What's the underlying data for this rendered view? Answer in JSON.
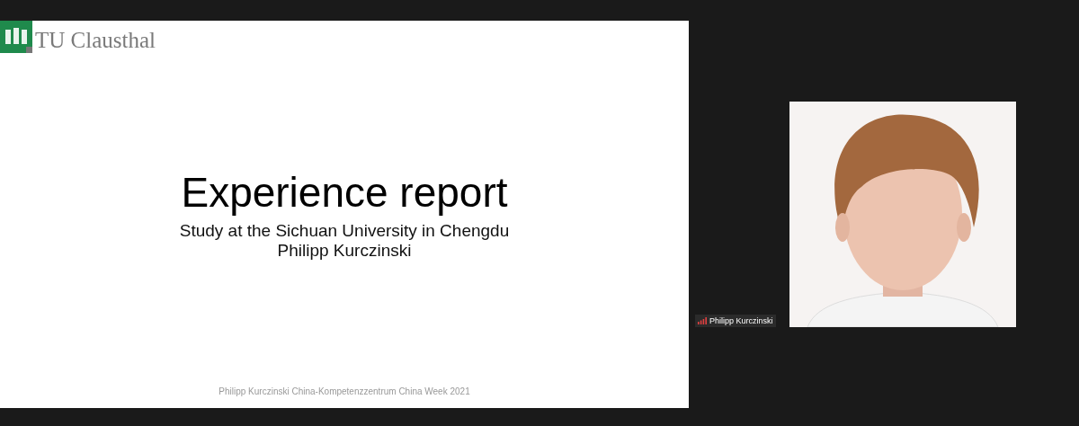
{
  "slide": {
    "logo": "TU Clausthal",
    "title": "Experience report",
    "subtitle_lines": [
      "Study at the Sichuan University in Chengdu",
      "Philipp Kurczinski"
    ],
    "footer": "Philipp Kurczinski China-Kompetenzzentrum China Week 2021"
  },
  "participant": {
    "name": "Philipp Kurczinski"
  }
}
